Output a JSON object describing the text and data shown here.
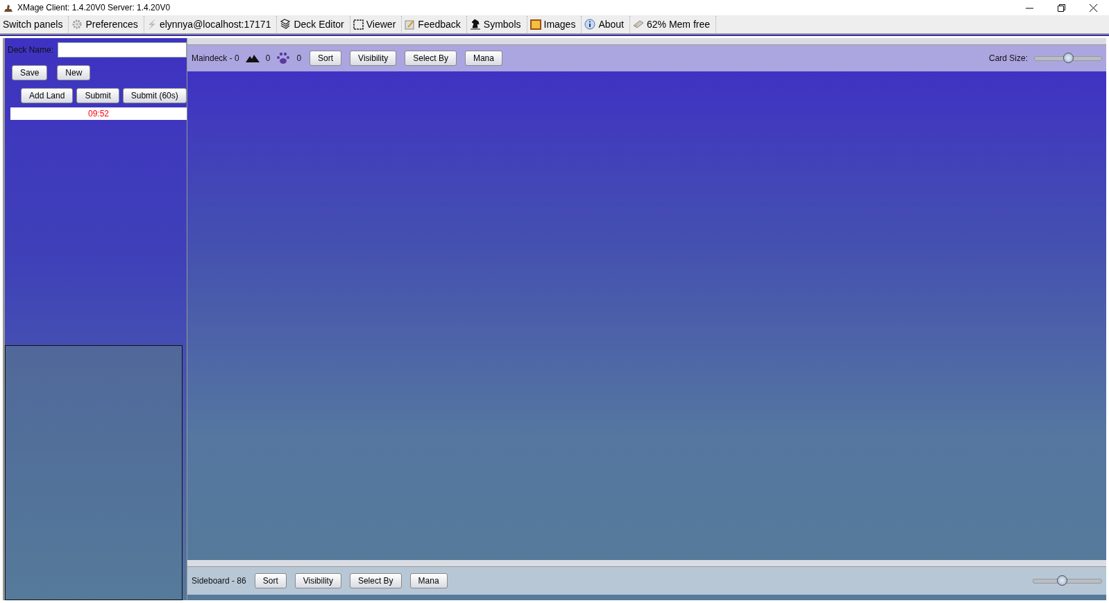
{
  "window": {
    "title": "XMage  Client: 1.4.20V0  Server: 1.4.20V0"
  },
  "menu": [
    {
      "label": "Switch panels"
    },
    {
      "label": "Preferences"
    },
    {
      "label": "elynnya@localhost:17171"
    },
    {
      "label": "Deck Editor"
    },
    {
      "label": "Viewer"
    },
    {
      "label": "Feedback"
    },
    {
      "label": "Symbols"
    },
    {
      "label": "Images"
    },
    {
      "label": "About"
    },
    {
      "label": "62% Mem free"
    }
  ],
  "deck": {
    "name_label": "Deck Name:",
    "buttons_row1": [
      "Save",
      "New"
    ],
    "buttons_row2": [
      "Add Land",
      "Submit",
      "Submit (60s)"
    ],
    "timer": "09:52"
  },
  "maindeck": {
    "label": "Maindeck - 0",
    "lands": "0",
    "creatures": "0",
    "buttons": [
      "Sort",
      "Visibility",
      "Select By",
      "Mana"
    ],
    "card_size_label": "Card Size:",
    "card_size": {
      "level": 0.5
    }
  },
  "sideboard": {
    "label": "Sideboard - 86",
    "buttons": [
      "Sort",
      "Visibility",
      "Select By",
      "Mana"
    ],
    "card_size": {
      "level": 0.42
    }
  }
}
